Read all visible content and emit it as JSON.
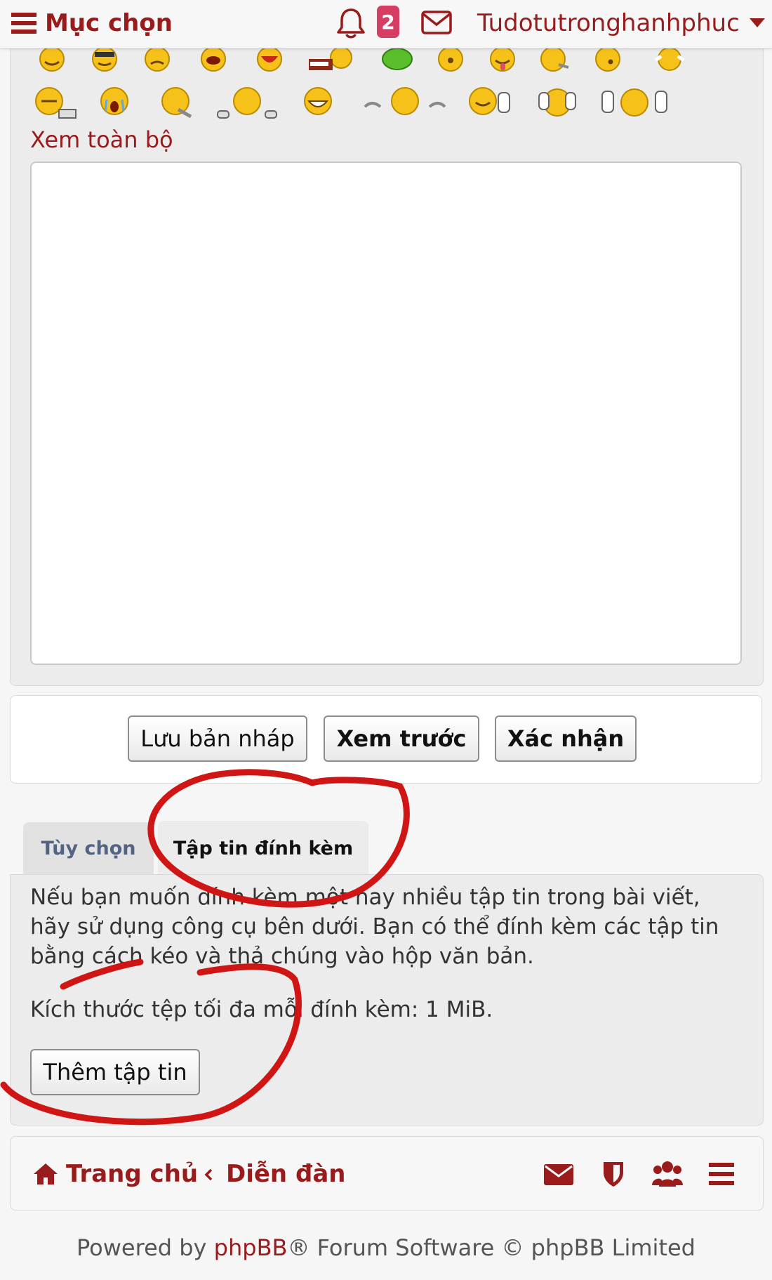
{
  "topbar": {
    "menu_label": "Mục chọn",
    "notification_count": "2",
    "username": "Tudotutronghanhphuc",
    "icons": [
      "hamburger-icon",
      "bell-icon",
      "envelope-icon",
      "caret-down-icon"
    ]
  },
  "editor": {
    "view_all": "Xem toàn bộ",
    "message": ""
  },
  "buttons": {
    "save_draft": "Lưu bản nháp",
    "preview": "Xem trước",
    "submit": "Xác nhận"
  },
  "tabs": {
    "options": "Tùy chọn",
    "attachments": "Tập tin đính kèm"
  },
  "attachments": {
    "help": "Nếu bạn muốn đính kèm một hay nhiều tập tin trong bài viết, hãy sử dụng công cụ bên dưới. Bạn có thể đính kèm các tập tin bằng cách kéo và thả chúng vào hộp văn bản.",
    "max_size": "Kích thước tệp tối đa mỗi đính kèm: 1 MiB.",
    "add_file": "Thêm tập tin"
  },
  "footer": {
    "home": "Trang chủ",
    "forum": "Diễn đàn",
    "icons": [
      "envelope-icon",
      "shield-icon",
      "users-icon",
      "hamburger-icon"
    ]
  },
  "powered": {
    "prefix": "Powered by ",
    "brand": "phpBB",
    "suffix": "® Forum Software © phpBB Limited"
  },
  "colors": {
    "accent": "#9a1b1b",
    "badge": "#d63d62",
    "annotation": "#d01515",
    "tab_inactive_text": "#536482"
  }
}
